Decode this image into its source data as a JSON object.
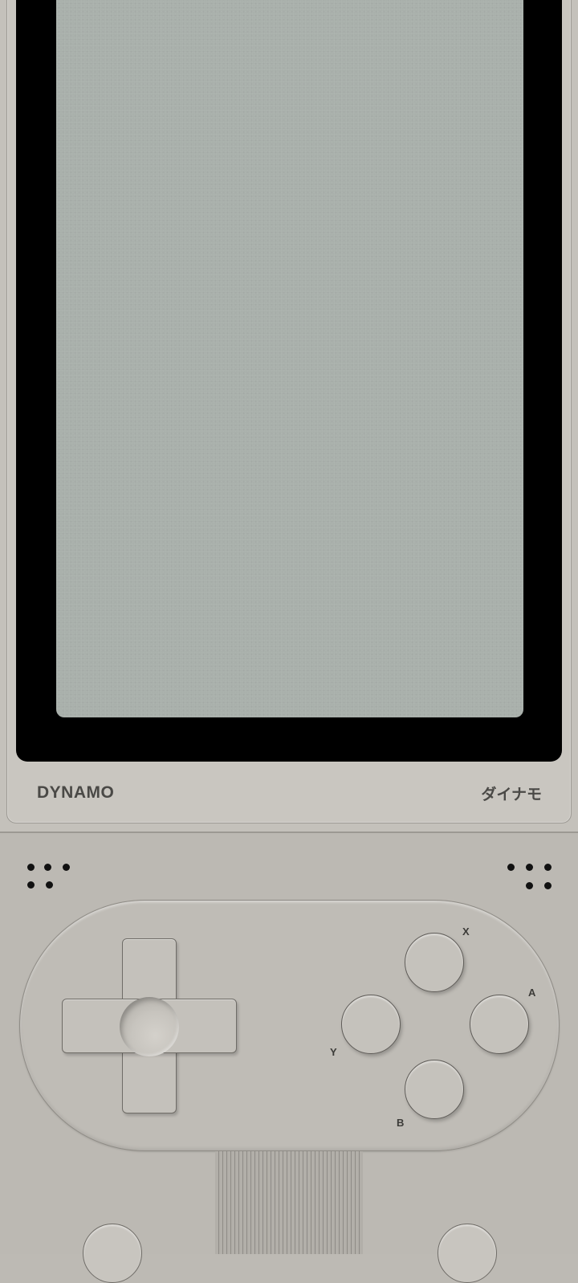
{
  "device": {
    "brand": "DYNAMO",
    "brand_jp": "ダイナモ"
  },
  "buttons": {
    "x_label": "X",
    "y_label": "Y",
    "a_label": "A",
    "b_label": "B"
  },
  "icons": {
    "dpad": "directional-pad-icon",
    "speaker_left": "speaker-dots-icon",
    "speaker_right": "speaker-dots-icon"
  },
  "colors": {
    "lcd": "#a9b0ab",
    "body": "#c4c1bb",
    "bezel": "#000000"
  }
}
